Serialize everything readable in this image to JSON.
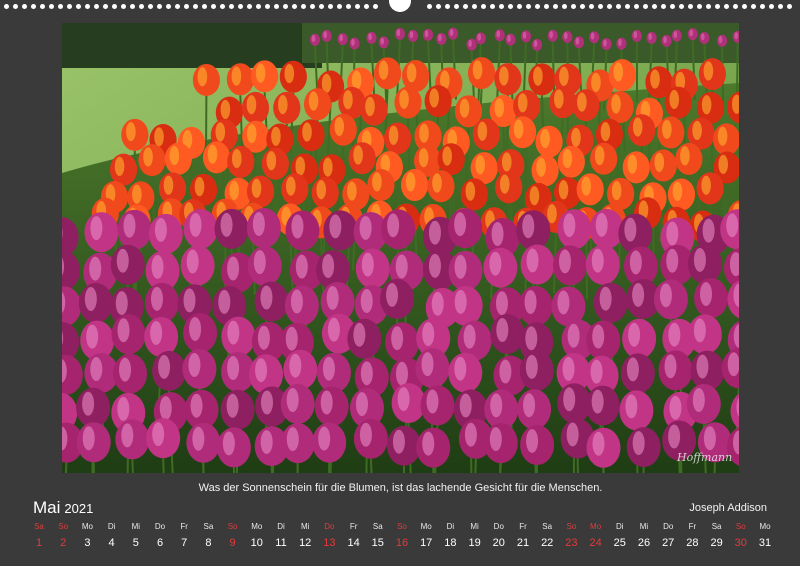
{
  "photo": {
    "subject": "tulip-field",
    "signature": "Hoffmann"
  },
  "colors": {
    "background": "#3a3a3a",
    "holiday": "#e23b3b",
    "text": "#ffffff"
  },
  "caption": {
    "quote": "Was der Sonnenschein für die Blumen, ist das lachende Gesicht für die Menschen.",
    "author": "Joseph Addison"
  },
  "calendar": {
    "month": "Mai",
    "year": "2021",
    "days": [
      {
        "name": "Sa",
        "num": "1",
        "red": true
      },
      {
        "name": "So",
        "num": "2",
        "red": true
      },
      {
        "name": "Mo",
        "num": "3",
        "red": false
      },
      {
        "name": "Di",
        "num": "4",
        "red": false
      },
      {
        "name": "Mi",
        "num": "5",
        "red": false
      },
      {
        "name": "Do",
        "num": "6",
        "red": false
      },
      {
        "name": "Fr",
        "num": "7",
        "red": false
      },
      {
        "name": "Sa",
        "num": "8",
        "red": false
      },
      {
        "name": "So",
        "num": "9",
        "red": true
      },
      {
        "name": "Mo",
        "num": "10",
        "red": false
      },
      {
        "name": "Di",
        "num": "11",
        "red": false
      },
      {
        "name": "Mi",
        "num": "12",
        "red": false
      },
      {
        "name": "Do",
        "num": "13",
        "red": true
      },
      {
        "name": "Fr",
        "num": "14",
        "red": false
      },
      {
        "name": "Sa",
        "num": "15",
        "red": false
      },
      {
        "name": "So",
        "num": "16",
        "red": true
      },
      {
        "name": "Mo",
        "num": "17",
        "red": false
      },
      {
        "name": "Di",
        "num": "18",
        "red": false
      },
      {
        "name": "Mi",
        "num": "19",
        "red": false
      },
      {
        "name": "Do",
        "num": "20",
        "red": false
      },
      {
        "name": "Fr",
        "num": "21",
        "red": false
      },
      {
        "name": "Sa",
        "num": "22",
        "red": false
      },
      {
        "name": "So",
        "num": "23",
        "red": true
      },
      {
        "name": "Mo",
        "num": "24",
        "red": true
      },
      {
        "name": "Di",
        "num": "25",
        "red": false
      },
      {
        "name": "Mi",
        "num": "26",
        "red": false
      },
      {
        "name": "Do",
        "num": "27",
        "red": false
      },
      {
        "name": "Fr",
        "num": "28",
        "red": false
      },
      {
        "name": "Sa",
        "num": "29",
        "red": false
      },
      {
        "name": "So",
        "num": "30",
        "red": true
      },
      {
        "name": "Mo",
        "num": "31",
        "red": false
      }
    ]
  }
}
